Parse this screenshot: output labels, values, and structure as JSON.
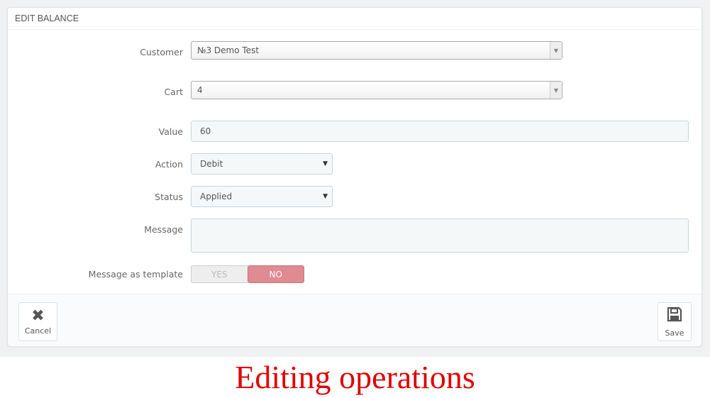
{
  "panel": {
    "title": "EDIT BALANCE"
  },
  "form": {
    "customer": {
      "label": "Customer",
      "value": "№3 Demo Test"
    },
    "cart": {
      "label": "Cart",
      "value": "4"
    },
    "value": {
      "label": "Value",
      "value": "60"
    },
    "action": {
      "label": "Action",
      "value": "Debit"
    },
    "status": {
      "label": "Status",
      "value": "Applied"
    },
    "message": {
      "label": "Message",
      "value": ""
    },
    "template": {
      "label": "Message as template",
      "yes": "YES",
      "no": "NO",
      "selected": "NO"
    }
  },
  "footer": {
    "cancel": "Cancel",
    "save": "Save"
  },
  "caption": "Editing operations",
  "colors": {
    "no_active": "#e08a92",
    "caption": "#e00000"
  }
}
